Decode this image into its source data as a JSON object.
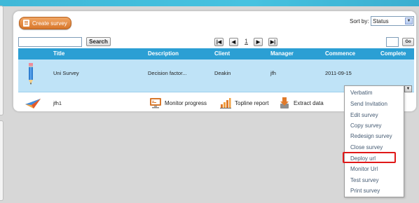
{
  "toolbar": {
    "create_label": "Create survey",
    "sort_label": "Sort by:",
    "sort_value": "Status",
    "search_button": "Search",
    "search_value": "",
    "page_number": "1",
    "go_label": "Go",
    "pager_first_icon": "first-page-icon",
    "pager_prev_icon": "prev-page-icon",
    "pager_next_icon": "next-page-icon",
    "pager_last_icon": "last-page-icon"
  },
  "table": {
    "headers": [
      "Title",
      "Description",
      "Client",
      "Manager",
      "Commence",
      "Complete"
    ],
    "rows": [
      {
        "icon": "pencil-icon",
        "title": "Uni Survey",
        "description": "Decision factor...",
        "client": "Deakin",
        "manager": "jfh",
        "commence": "2011-09-15",
        "complete": ""
      },
      {
        "icon": "paper-plane-icon",
        "title": "jfh1",
        "actions": [
          {
            "icon": "monitor-icon",
            "label": "Monitor progress"
          },
          {
            "icon": "bar-chart-icon",
            "label": "Topline report"
          },
          {
            "icon": "download-icon",
            "label": "Extract data"
          },
          {
            "icon": "action-icon",
            "label": ""
          }
        ]
      }
    ]
  },
  "dropdown": {
    "items": [
      "Verbatim",
      "Send Invitation",
      "Edit survey",
      "Copy survey",
      "Redesign survey",
      "Close survey",
      "Deploy url",
      "Monitor Url",
      "Test survey",
      "Print survey"
    ],
    "highlighted": "Deploy url"
  },
  "colors": {
    "header_blue": "#2b9fd4",
    "row_highlight": "#bfe3f7",
    "accent_orange": "#d8772b",
    "highlight_red": "#e01818"
  }
}
